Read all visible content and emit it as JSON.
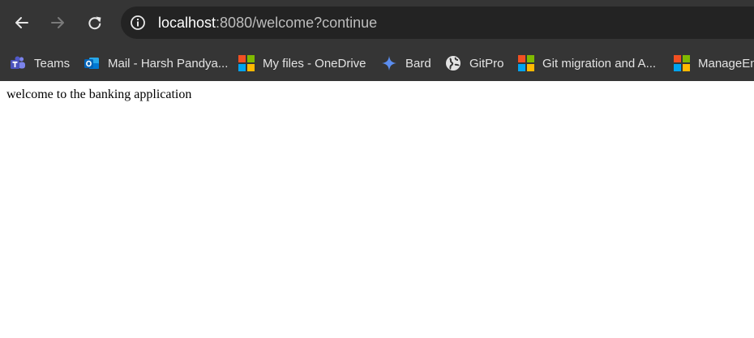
{
  "browser": {
    "url_host": "localhost",
    "url_rest": ":8080/welcome?continue",
    "icons": {
      "back": "back-arrow-icon",
      "forward": "forward-arrow-icon",
      "reload": "reload-icon",
      "info": "site-info-icon"
    }
  },
  "bookmarks": [
    {
      "label": "Teams",
      "icon": "teams-icon"
    },
    {
      "label": "Mail - Harsh Pandya...",
      "icon": "outlook-icon"
    },
    {
      "label": "My files - OneDrive",
      "icon": "microsoft-icon"
    },
    {
      "label": "Bard",
      "icon": "bard-sparkle-icon"
    },
    {
      "label": "GitPro",
      "icon": "globe-icon"
    },
    {
      "label": "Git migration and A...",
      "icon": "microsoft-icon"
    },
    {
      "label": "ManageEng",
      "icon": "microsoft-icon"
    }
  ],
  "page": {
    "message": "welcome to the banking application"
  },
  "colors": {
    "toolbar_bg": "#353535",
    "omnibox_bg": "#232323",
    "ms_red": "#f25022",
    "ms_green": "#7fba00",
    "ms_blue": "#00a4ef",
    "ms_yellow": "#ffb900"
  }
}
